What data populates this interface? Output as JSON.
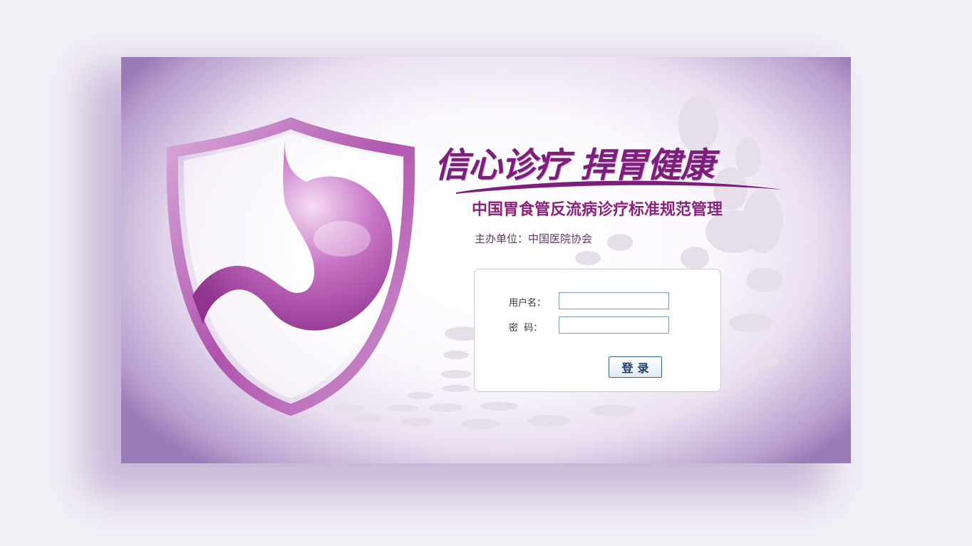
{
  "banner": {
    "slogan": "信心诊疗 捍胃健康",
    "subtitle": "中国胃食管反流病诊疗标准规范管理",
    "organizer": "主办单位：中国医院协会"
  },
  "login": {
    "username_label": "用户名：",
    "username_value": "",
    "password_label": "密  码：",
    "password_value": "",
    "submit_label": "登录"
  },
  "colors": {
    "brand_purple": "#7b1f7a",
    "subtitle_purple": "#8a237c",
    "button_text": "#1d3d66",
    "input_border": "#7b9ebd"
  }
}
